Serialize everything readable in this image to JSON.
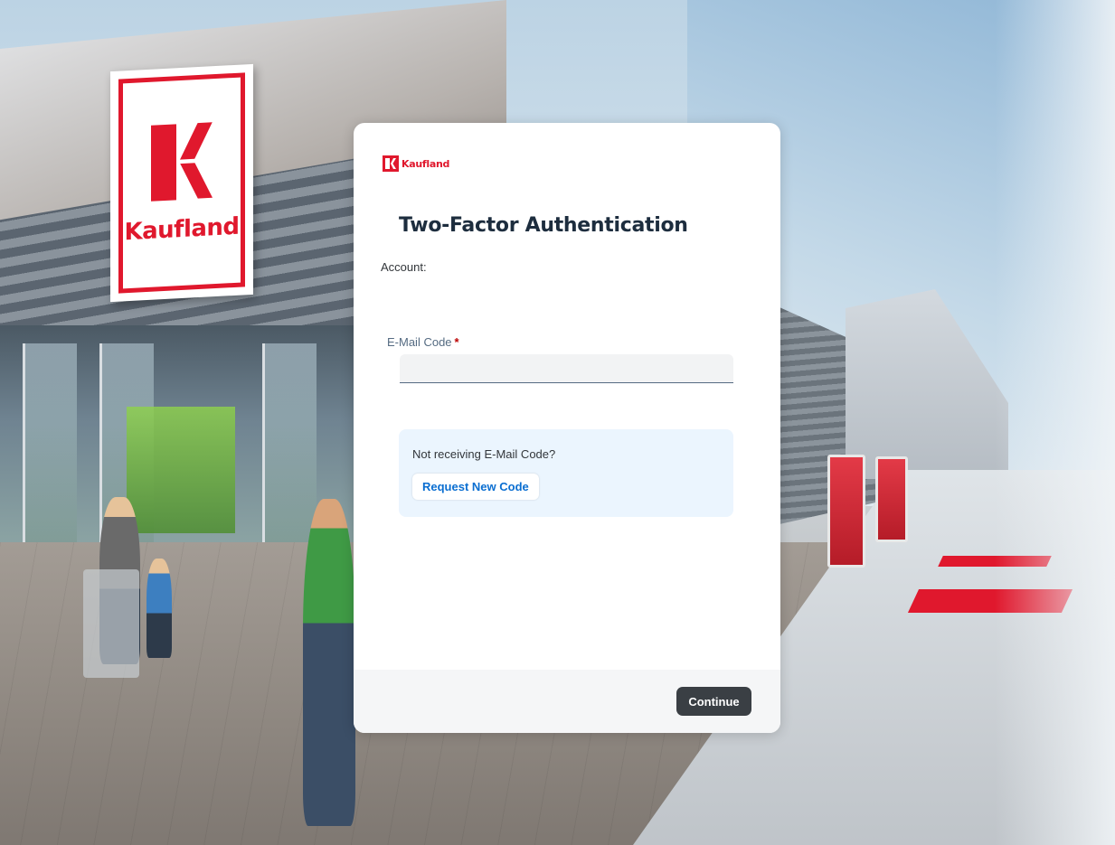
{
  "background": {
    "sign_text": "Kaufland",
    "brand_color": "#e0182d"
  },
  "card": {
    "logo_text": "Kaufland",
    "title": "Two-Factor Authentication",
    "account_label": "Account:",
    "email_code": {
      "label": "E-Mail Code",
      "required_marker": "*",
      "value": "",
      "placeholder": ""
    },
    "info": {
      "text": "Not receiving E-Mail Code?",
      "request_button": "Request New Code"
    },
    "footer": {
      "continue_button": "Continue"
    }
  },
  "colors": {
    "primary_button": "#3a3f44",
    "link": "#0a6ed1",
    "info_background": "#ebf5fe",
    "required": "#bb0000"
  }
}
